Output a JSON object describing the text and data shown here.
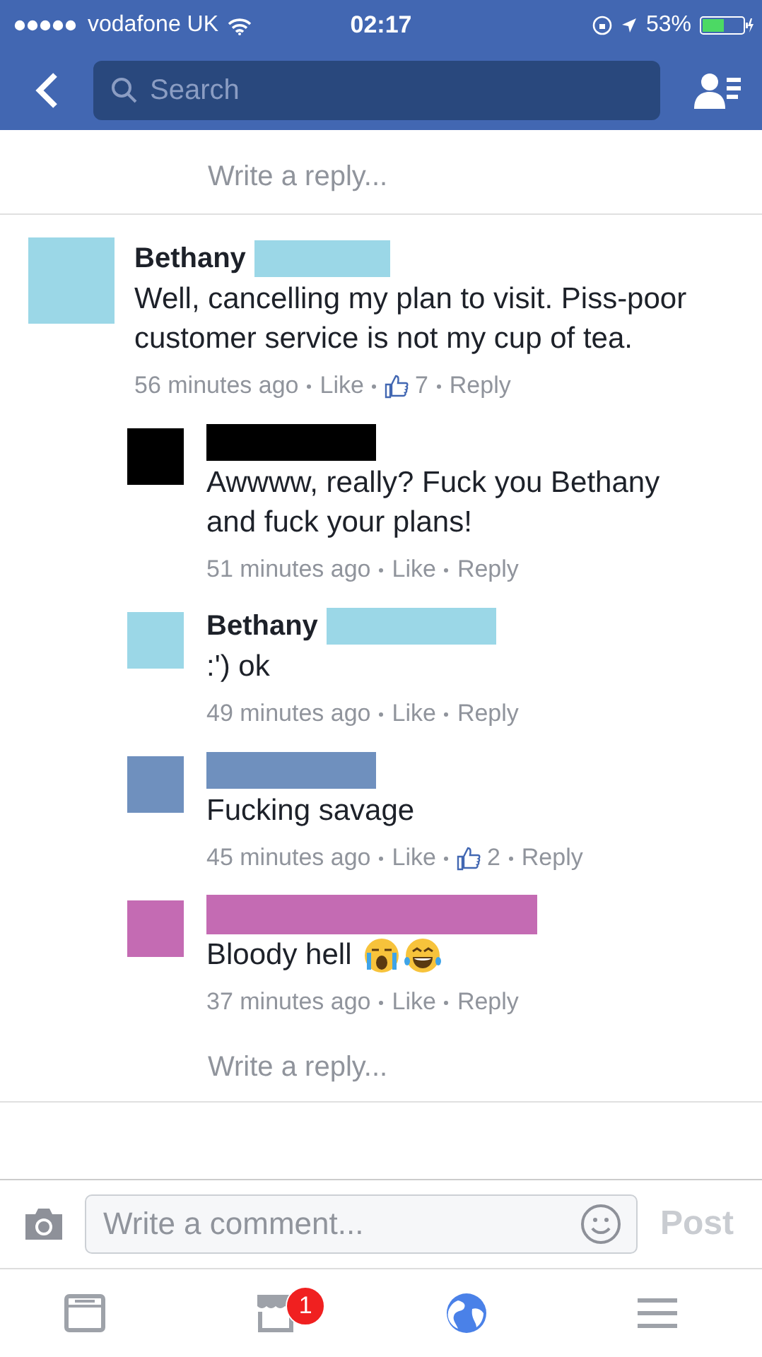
{
  "status_bar": {
    "carrier": "vodafone UK",
    "time": "02:17",
    "battery": "53%"
  },
  "nav": {
    "search": {
      "placeholder": "Search"
    }
  },
  "previous_reply_box": {
    "placeholder": "Write a reply..."
  },
  "comment": {
    "name": "Bethany",
    "color": "#9bd7e7",
    "text": "Well, cancelling my plan to visit. Piss-poor customer service is not my cup of tea.",
    "time": "56 minutes ago",
    "like": "Like",
    "likes": "7",
    "reply": "Reply"
  },
  "replies": [
    {
      "kind": "text",
      "color": "#000000",
      "text": "Awwww, really? Fuck you Bethany and fuck your plans!",
      "time": "51 minutes ago",
      "like": "Like",
      "reply": "Reply"
    },
    {
      "kind": "text",
      "name": "Bethany",
      "color": "#9bd7e7",
      "text": ":') ok",
      "time": "49 minutes ago",
      "like": "Like",
      "reply": "Reply"
    },
    {
      "kind": "text",
      "color": "#6f90be",
      "text": "Fucking savage",
      "time": "45 minutes ago",
      "like": "Like",
      "likes": "2",
      "reply": "Reply"
    },
    {
      "kind": "emoji",
      "color": "#c46bb3",
      "text": "Bloody hell",
      "time": "37 minutes ago",
      "like": "Like",
      "reply": "Reply"
    }
  ],
  "reply_box": {
    "placeholder": "Write a reply..."
  },
  "composer": {
    "placeholder": "Write a comment...",
    "post": "Post"
  },
  "tab_bar": [
    {
      "kind": "feed",
      "selected": false
    },
    {
      "kind": "market",
      "selected": false,
      "badge": "1"
    },
    {
      "kind": "globe",
      "selected": true
    },
    {
      "kind": "menu",
      "selected": false
    }
  ]
}
